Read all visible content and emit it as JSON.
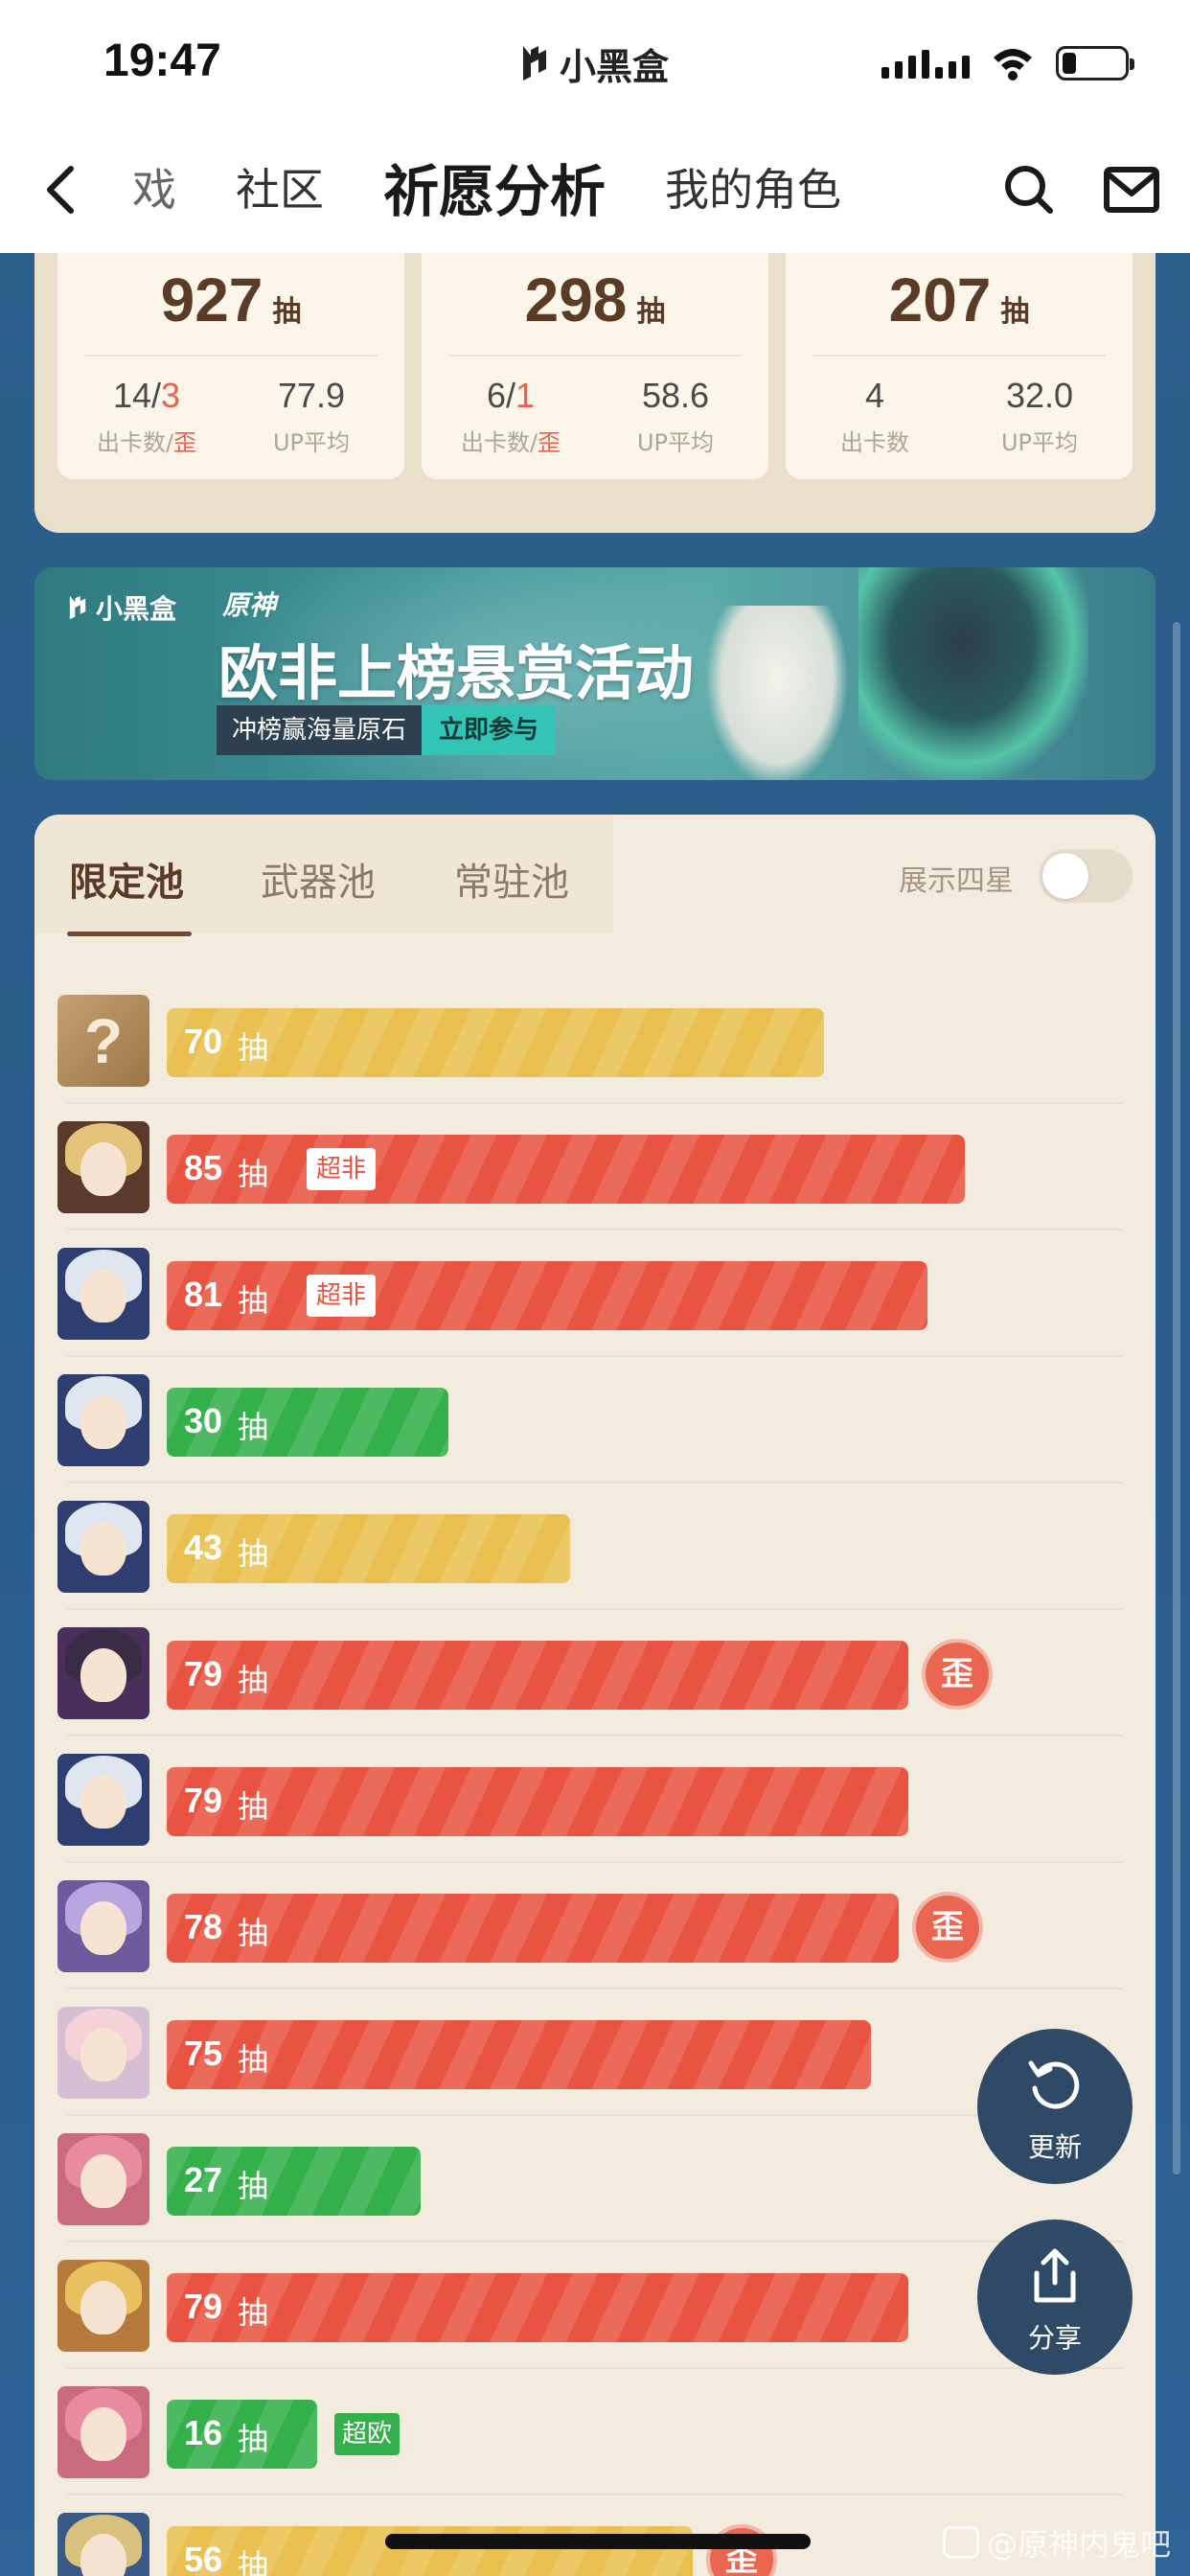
{
  "status_bar": {
    "time": "19:47",
    "app_name": "小黑盒",
    "battery_level": 0.22
  },
  "nav": {
    "partial_tab": "戏",
    "tabs": [
      "社区",
      "祈愿分析",
      "我的角色"
    ],
    "active_tab": "祈愿分析",
    "icons": [
      "back-icon",
      "search-icon",
      "mail-icon"
    ]
  },
  "stats": [
    {
      "total": "927",
      "unit": "抽",
      "cards": "14",
      "lost": "3",
      "cards_label": "出卡数",
      "lost_label": "歪",
      "slash": "/",
      "avg": "77.9",
      "avg_label": "UP平均"
    },
    {
      "total": "298",
      "unit": "抽",
      "cards": "6",
      "lost": "1",
      "cards_label": "出卡数",
      "lost_label": "歪",
      "slash": "/",
      "avg": "58.6",
      "avg_label": "UP平均"
    },
    {
      "total": "207",
      "unit": "抽",
      "cards": "4",
      "lost": "",
      "cards_label": "出卡数",
      "lost_label": "",
      "slash": "",
      "avg": "32.0",
      "avg_label": "UP平均"
    }
  ],
  "banner": {
    "brand": "小黑盒",
    "game": "原神",
    "title": "欧非上榜悬赏活动",
    "subtitle": "冲榜赢海量原石",
    "cta": "立即参与"
  },
  "pool": {
    "tabs": [
      "限定池",
      "武器池",
      "常驻池"
    ],
    "active_tab": "限定池",
    "four_star_label": "展示四星",
    "four_star_on": false,
    "unit": "抽",
    "max_pulls": 90,
    "rows": [
      {
        "pulls": 70,
        "color": "yellow",
        "tag": "",
        "lost": false,
        "avatar": "mystery"
      },
      {
        "pulls": 85,
        "color": "red",
        "tag": "超非",
        "lost": false,
        "avatar": "blonde"
      },
      {
        "pulls": 81,
        "color": "red",
        "tag": "超非",
        "lost": false,
        "avatar": "silver"
      },
      {
        "pulls": 30,
        "color": "green",
        "tag": "",
        "lost": false,
        "avatar": "silver"
      },
      {
        "pulls": 43,
        "color": "yellow",
        "tag": "",
        "lost": false,
        "avatar": "silver"
      },
      {
        "pulls": 79,
        "color": "red",
        "tag": "",
        "lost": true,
        "avatar": "witch"
      },
      {
        "pulls": 79,
        "color": "red",
        "tag": "",
        "lost": false,
        "avatar": "silver"
      },
      {
        "pulls": 78,
        "color": "red",
        "tag": "",
        "lost": true,
        "avatar": "lavender"
      },
      {
        "pulls": 75,
        "color": "red",
        "tag": "",
        "lost": false,
        "avatar": "pink"
      },
      {
        "pulls": 27,
        "color": "green",
        "tag": "",
        "lost": false,
        "avatar": "rose"
      },
      {
        "pulls": 79,
        "color": "red",
        "tag": "",
        "lost": false,
        "avatar": "gold"
      },
      {
        "pulls": 16,
        "color": "green",
        "tag_out": "超欧",
        "lost": false,
        "avatar": "rose"
      },
      {
        "pulls": 56,
        "color": "yellow",
        "tag": "",
        "lost": true,
        "avatar": "blue-blonde"
      }
    ],
    "lost_mark": "歪"
  },
  "fab": {
    "refresh_label": "更新",
    "share_label": "分享"
  },
  "watermark": "@原神内鬼吧",
  "colors": {
    "red": "#e85441",
    "yellow": "#e9c04f",
    "green": "#33b04a",
    "accent_brown": "#5a3b26"
  }
}
